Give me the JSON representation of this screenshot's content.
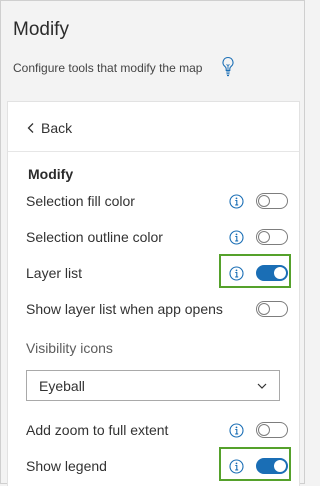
{
  "header": {
    "title": "Modify",
    "subtitle": "Configure tools that modify the map",
    "hint_icon": "lightbulb-icon"
  },
  "nav": {
    "back_label": "Back",
    "back_icon": "chevron-left-icon"
  },
  "section": {
    "title": "Modify"
  },
  "settings": [
    {
      "label": "Selection fill color",
      "info": true,
      "enabled": false
    },
    {
      "label": "Selection outline color",
      "info": true,
      "enabled": false
    },
    {
      "label": "Layer list",
      "info": true,
      "enabled": true,
      "highlighted": true
    },
    {
      "label": "Show layer list when app opens",
      "info": false,
      "enabled": false
    }
  ],
  "visibility_icons": {
    "label": "Visibility icons",
    "selected": "Eyeball"
  },
  "extra_settings": [
    {
      "label": "Add zoom to full extent",
      "info": true,
      "enabled": false
    },
    {
      "label": "Show legend",
      "info": true,
      "enabled": true,
      "highlighted": true
    }
  ],
  "colors": {
    "toggle_on": "#1a6eb5",
    "info_icon": "#1a6eb5",
    "highlight": "#55a12b"
  }
}
